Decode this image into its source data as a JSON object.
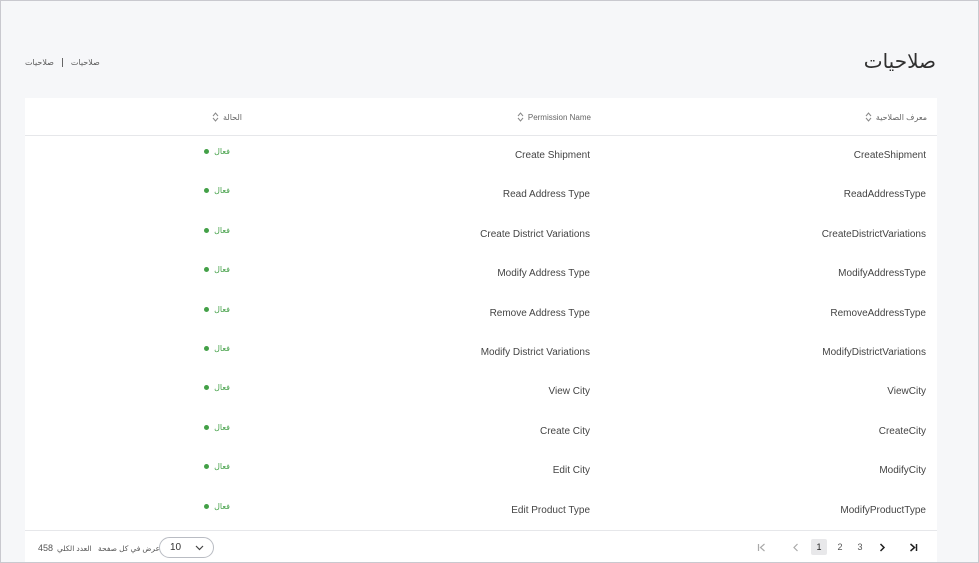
{
  "page": {
    "title": "صلاحيات"
  },
  "breadcrumb": {
    "parent": "صلاحيات",
    "current": "صلاحيات"
  },
  "table": {
    "columns": {
      "id": "معرف الصلاحية",
      "name": "Permission Name",
      "status": "الحالة"
    },
    "rows": [
      {
        "id": "CreateShipment",
        "name": "Create Shipment",
        "status": "فعال"
      },
      {
        "id": "ReadAddressType",
        "name": "Read Address Type",
        "status": "فعال"
      },
      {
        "id": "CreateDistrictVariations",
        "name": "Create District Variations",
        "status": "فعال"
      },
      {
        "id": "ModifyAddressType",
        "name": "Modify Address Type",
        "status": "فعال"
      },
      {
        "id": "RemoveAddressType",
        "name": "Remove Address Type",
        "status": "فعال"
      },
      {
        "id": "ModifyDistrictVariations",
        "name": "Modify District Variations",
        "status": "فعال"
      },
      {
        "id": "ViewCity",
        "name": "View City",
        "status": "فعال"
      },
      {
        "id": "CreateCity",
        "name": "Create City",
        "status": "فعال"
      },
      {
        "id": "ModifyCity",
        "name": "Edit City",
        "status": "فعال"
      },
      {
        "id": "ModifyProductType",
        "name": "Edit Product Type",
        "status": "فعال"
      }
    ]
  },
  "footer": {
    "total_label": "العدد الكلي",
    "total_value": "458",
    "per_page_label": "عرض في كل صفحة",
    "per_page_value": "10",
    "pages": [
      "1",
      "2",
      "3"
    ],
    "current_page": "1"
  },
  "colors": {
    "status_active": "#43a047"
  },
  "icons": {
    "sort": "sort-icon",
    "status": "status-dot-icon",
    "first": "first-page-icon",
    "prev": "chevron-left-icon",
    "next": "chevron-right-icon",
    "last": "last-page-icon",
    "select": "chevron-down-icon"
  }
}
